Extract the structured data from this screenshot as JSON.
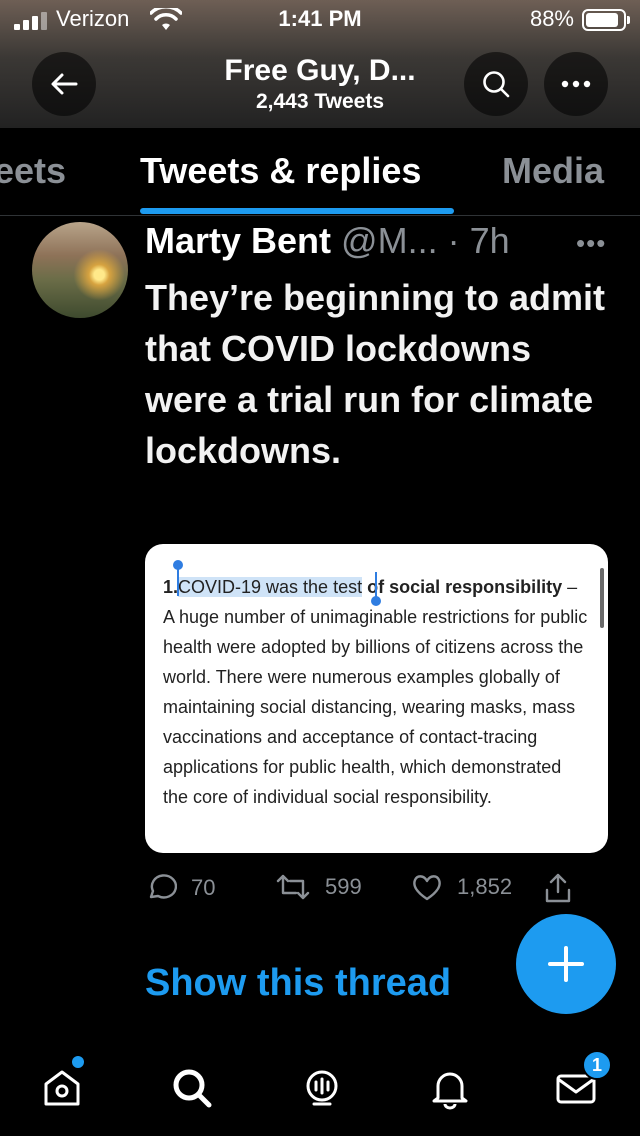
{
  "status_bar": {
    "carrier": "Verizon",
    "time": "1:41 PM",
    "battery": "88%"
  },
  "header": {
    "title": "Free Guy, D...",
    "subtitle": "2,443 Tweets"
  },
  "tabs": [
    {
      "label": "eets",
      "active": false
    },
    {
      "label": "Tweets & replies",
      "active": true
    },
    {
      "label": "Media",
      "active": false
    }
  ],
  "tweet": {
    "author_name": "Marty Bent",
    "author_handle": "@M... · 7h",
    "text": "They’re beginning to admit that COVID lockdowns were a trial run for climate lockdowns.",
    "card": {
      "number": "1.",
      "highlighted": "COVID-19 was the test",
      "bold_rest": " of social responsibility",
      "body": "– A huge number of unimaginable restrictions for public health were adopted by billions of citizens across the world. There were numerous examples globally of maintaining social distancing, wearing masks, mass vaccinations and acceptance of contact-tracing applications for public health, which demonstrated the core of individual social responsibility."
    },
    "actions": {
      "replies": "70",
      "retweets": "599",
      "likes": "1,852"
    },
    "show_thread": "Show this thread"
  },
  "bottom_nav": {
    "messages_badge": "1"
  },
  "colors": {
    "accent": "#1d9bf0",
    "muted": "#8b9096",
    "background": "#000000"
  }
}
